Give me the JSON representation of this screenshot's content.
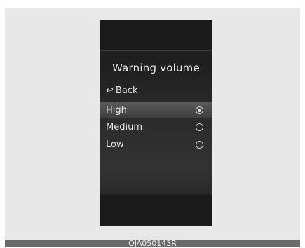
{
  "screen": {
    "title": "Warning volume",
    "back_label": "Back",
    "back_icon": "↩",
    "options": [
      {
        "label": "High",
        "selected": true
      },
      {
        "label": "Medium",
        "selected": false
      },
      {
        "label": "Low",
        "selected": false
      }
    ]
  },
  "caption": "OJA050143R",
  "colors": {
    "screen_bg": "#2a2a2a",
    "selected_bg": "#4f4f4f",
    "text": "#e8e8e8",
    "frame": "#e8e8e8"
  }
}
